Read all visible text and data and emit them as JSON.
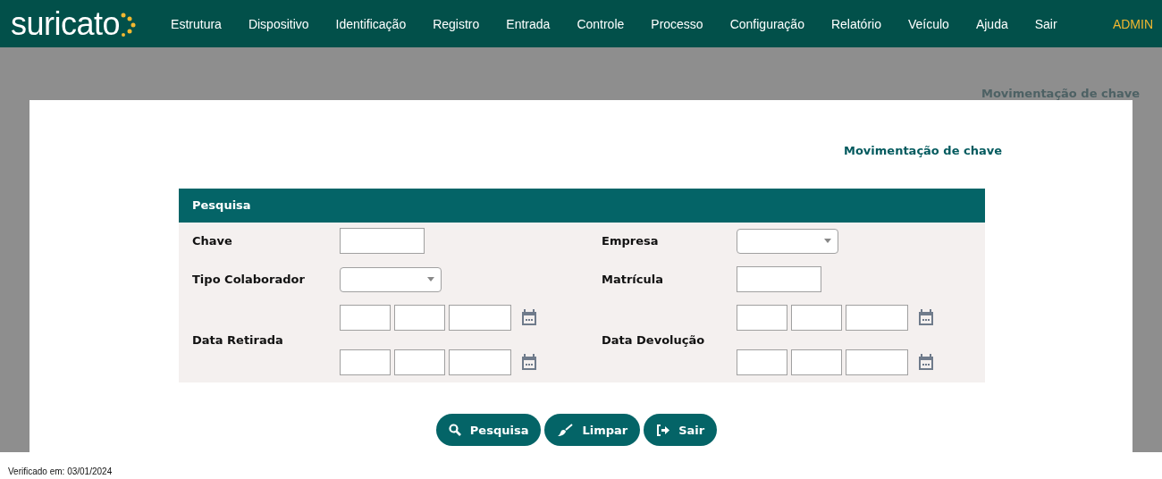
{
  "navbar": {
    "logo": "suricato",
    "menu": [
      "Estrutura",
      "Dispositivo",
      "Identificação",
      "Registro",
      "Entrada",
      "Controle",
      "Processo",
      "Configuração",
      "Relatório",
      "Veículo",
      "Ajuda",
      "Sair"
    ],
    "user": "ADMIN"
  },
  "background_title": "Movimentação de chave",
  "dialog": {
    "title": "Movimentação de chave",
    "panel": {
      "title": "Pesquisa",
      "fields": [
        {
          "label": "Chave",
          "kind": "text"
        },
        {
          "label": "Empresa",
          "kind": "select"
        },
        {
          "label": "Tipo Colaborador",
          "kind": "select"
        },
        {
          "label": "Matrícula",
          "kind": "text"
        },
        {
          "label": "Data Retirada",
          "kind": "daterange"
        },
        {
          "label": "Data Devolução",
          "kind": "daterange"
        }
      ]
    },
    "buttons": [
      {
        "label": "Pesquisa",
        "kind": "search"
      },
      {
        "label": "Limpar",
        "kind": "broom"
      },
      {
        "label": "Sair",
        "kind": "exit"
      }
    ]
  },
  "footer": "Verificado em: 03/01/2024"
}
